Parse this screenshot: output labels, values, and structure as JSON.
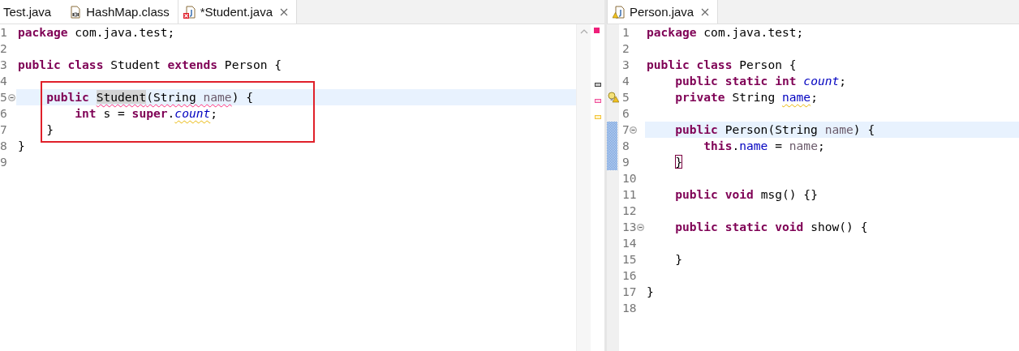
{
  "editors": [
    {
      "tabs": [
        {
          "label": "Test.java",
          "selected": false,
          "kind": "plain"
        },
        {
          "label": "HashMap.class",
          "selected": false,
          "kind": "class-file"
        },
        {
          "label": "*Student.java",
          "selected": true,
          "kind": "java-file",
          "error": true
        }
      ],
      "has_errors": true,
      "lines": [
        {
          "number": "1",
          "tokens": [
            {
              "text": "package",
              "kind": "keyword"
            },
            {
              "text": " com.java.test;",
              "kind": "plain"
            }
          ]
        },
        {
          "number": "2"
        },
        {
          "number": "3",
          "tokens": [
            {
              "text": "public ",
              "kind": "keyword"
            },
            {
              "text": "class",
              "kind": "keyword"
            },
            {
              "text": " Student ",
              "kind": "plain"
            },
            {
              "text": "extends",
              "kind": "keyword"
            },
            {
              "text": " Person {",
              "kind": "plain"
            }
          ]
        },
        {
          "number": "4",
          "occurrence": true
        },
        {
          "number": "5",
          "current": true,
          "fold": true,
          "boxed": true,
          "error": true,
          "tokens": [
            {
              "text": "    public ",
              "kind": "keyword"
            },
            {
              "text": "Student",
              "kind": "plain",
              "occurrence": true,
              "error": true
            },
            {
              "text": "(String ",
              "kind": "plain",
              "error": true
            },
            {
              "text": "name",
              "kind": "param",
              "error": true
            },
            {
              "text": ") {",
              "kind": "plain"
            }
          ]
        },
        {
          "number": "6",
          "boxed": true,
          "warning": true,
          "tokens": [
            {
              "text": "        int",
              "kind": "keyword"
            },
            {
              "text": " s = ",
              "kind": "plain"
            },
            {
              "text": "super",
              "kind": "keyword"
            },
            {
              "text": ".",
              "kind": "plain"
            },
            {
              "text": "count",
              "kind": "static-field",
              "warning": true
            },
            {
              "text": ";",
              "kind": "plain"
            }
          ]
        },
        {
          "number": "7",
          "boxed": true,
          "tokens": [
            {
              "text": "    }",
              "kind": "plain"
            }
          ]
        },
        {
          "number": "8",
          "tokens": [
            {
              "text": "}",
              "kind": "plain"
            }
          ]
        },
        {
          "number": "9"
        }
      ]
    },
    {
      "tabs": [
        {
          "label": "Person.java",
          "selected": true,
          "kind": "java-file",
          "warning": true
        }
      ],
      "lines": [
        {
          "number": "1",
          "tokens": [
            {
              "text": "package",
              "kind": "keyword"
            },
            {
              "text": " com.java.test;",
              "kind": "plain"
            }
          ]
        },
        {
          "number": "2"
        },
        {
          "number": "3",
          "tokens": [
            {
              "text": "public ",
              "kind": "keyword"
            },
            {
              "text": "class",
              "kind": "keyword"
            },
            {
              "text": " Person {",
              "kind": "plain"
            }
          ]
        },
        {
          "number": "4",
          "tokens": [
            {
              "text": "    public ",
              "kind": "keyword"
            },
            {
              "text": "static ",
              "kind": "keyword"
            },
            {
              "text": "int ",
              "kind": "keyword"
            },
            {
              "text": "count",
              "kind": "static-field"
            },
            {
              "text": ";",
              "kind": "plain"
            }
          ]
        },
        {
          "number": "5",
          "quick_fix": true,
          "tokens": [
            {
              "text": "    private",
              "kind": "keyword"
            },
            {
              "text": " String ",
              "kind": "plain"
            },
            {
              "text": "name",
              "kind": "field",
              "warning": true
            },
            {
              "text": ";",
              "kind": "plain"
            }
          ]
        },
        {
          "number": "6"
        },
        {
          "number": "7",
          "current": true,
          "fold": true,
          "changed": true,
          "tokens": [
            {
              "text": "    public",
              "kind": "keyword"
            },
            {
              "text": " Person(String ",
              "kind": "plain"
            },
            {
              "text": "name",
              "kind": "param"
            },
            {
              "text": ") {",
              "kind": "plain"
            }
          ]
        },
        {
          "number": "8",
          "changed": true,
          "tokens": [
            {
              "text": "        this",
              "kind": "keyword"
            },
            {
              "text": ".",
              "kind": "plain"
            },
            {
              "text": "name",
              "kind": "field"
            },
            {
              "text": " = ",
              "kind": "plain"
            },
            {
              "text": "name",
              "kind": "param"
            },
            {
              "text": ";",
              "kind": "plain"
            }
          ]
        },
        {
          "number": "9",
          "changed": true,
          "tokens": [
            {
              "text": "    }",
              "kind": "plain",
              "bracket_match": true
            }
          ]
        },
        {
          "number": "10"
        },
        {
          "number": "11",
          "tokens": [
            {
              "text": "    public ",
              "kind": "keyword"
            },
            {
              "text": "void",
              "kind": "keyword"
            },
            {
              "text": " msg() {}",
              "kind": "plain"
            }
          ]
        },
        {
          "number": "12"
        },
        {
          "number": "13",
          "fold": true,
          "tokens": [
            {
              "text": "    public ",
              "kind": "keyword"
            },
            {
              "text": "static ",
              "kind": "keyword"
            },
            {
              "text": "void",
              "kind": "keyword"
            },
            {
              "text": " show() {",
              "kind": "plain"
            }
          ]
        },
        {
          "number": "14"
        },
        {
          "number": "15",
          "tokens": [
            {
              "text": "    }",
              "kind": "plain"
            }
          ]
        },
        {
          "number": "16"
        },
        {
          "number": "17",
          "tokens": [
            {
              "text": "}",
              "kind": "plain"
            }
          ]
        },
        {
          "number": "18"
        }
      ]
    }
  ]
}
